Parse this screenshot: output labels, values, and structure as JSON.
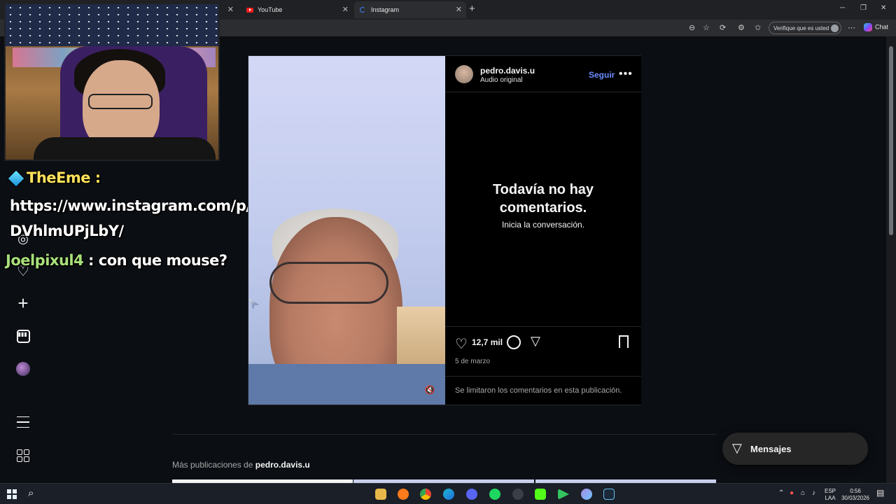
{
  "browser": {
    "tabs": [
      {
        "label": "",
        "active": false
      },
      {
        "label": "YouTube",
        "active": false
      },
      {
        "label": "Instagram",
        "active": true
      }
    ],
    "new_tab": "+",
    "verify_label": "Verifique que es usted",
    "chat_label": "Chat"
  },
  "stream_chat": [
    {
      "user": "TheEme",
      "sep": " :",
      "message": ""
    },
    {
      "user": "",
      "sep": "",
      "message": "https://www.instagram.com/p/"
    },
    {
      "user": "",
      "sep": "",
      "message": "DVhlmUPjLbY/"
    },
    {
      "user": "Joelpixul4",
      "sep": " :",
      "message": " con que mouse?"
    }
  ],
  "post": {
    "username": "pedro.davis.u",
    "audio": "Audio original",
    "follow": "Seguir",
    "no_comments_line1": "Todavía no hay",
    "no_comments_line2": "comentarios.",
    "start_conversation": "Inicia la conversación.",
    "likes": "12,7 mil",
    "date": "5 de marzo",
    "limited_comments": "Se limitaron los comentarios en esta publicación."
  },
  "more_posts": {
    "prefix": "Más publicaciones de ",
    "user": "pedro.davis.u"
  },
  "messages_button": "Mensajes",
  "taskbar": {
    "lang_top": "ESP",
    "lang_bottom": "LAA",
    "time": "0:56",
    "date": "30/03/2026"
  },
  "colors": {
    "accent": "#6a8cff",
    "background": "#0b0e13"
  }
}
